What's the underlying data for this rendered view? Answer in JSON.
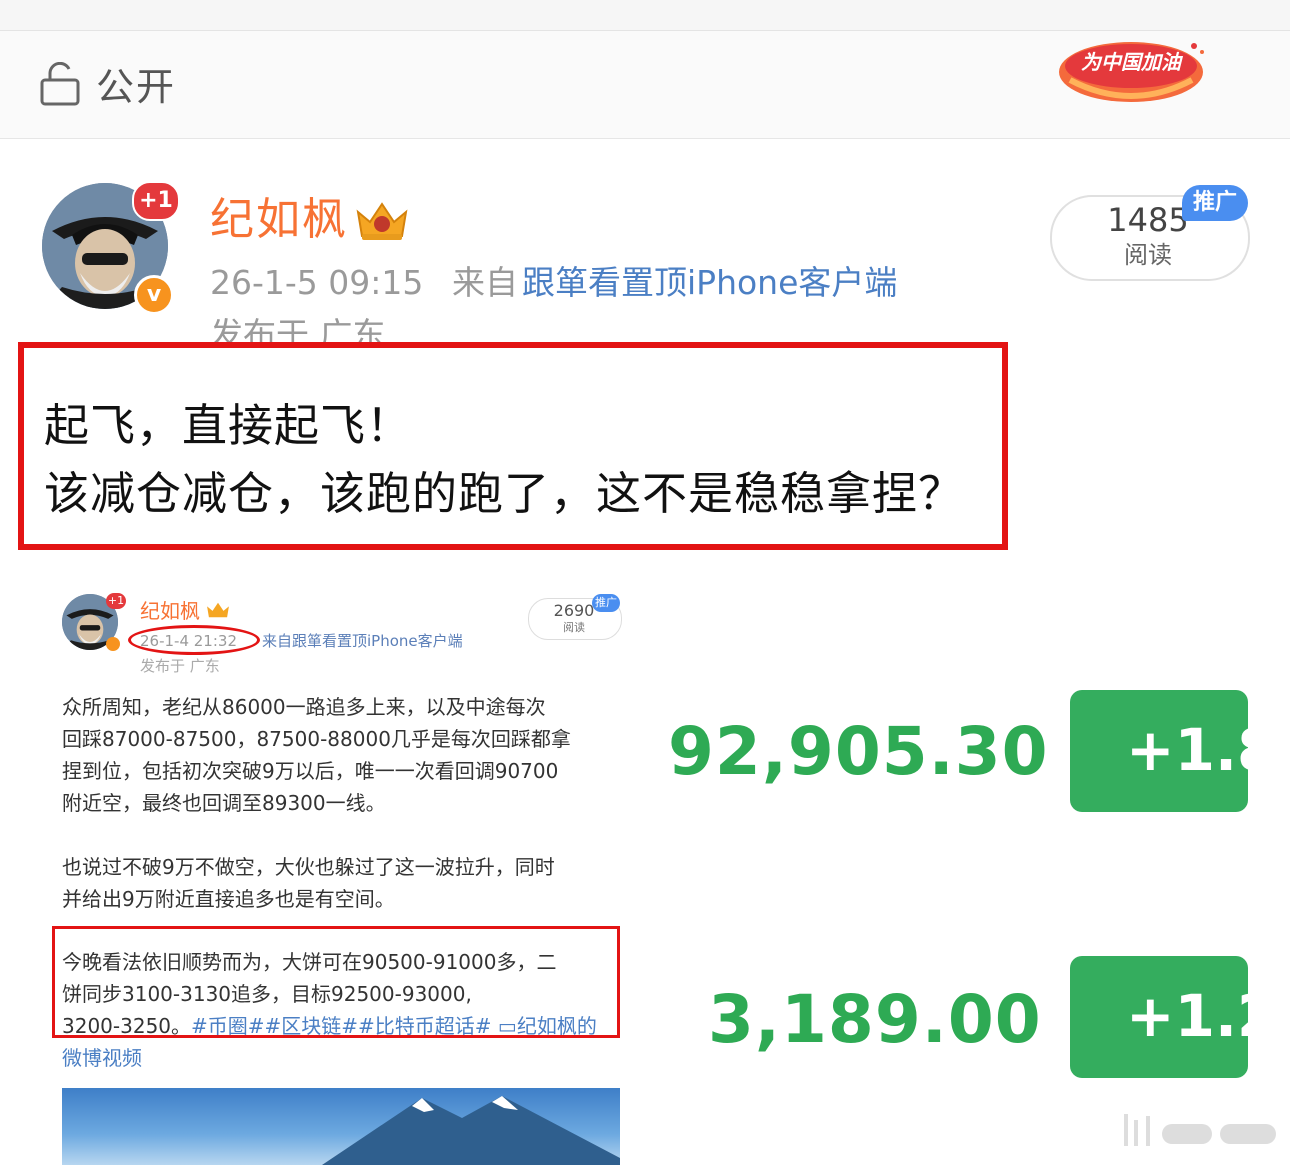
{
  "visibility": {
    "icon": "unlock-icon",
    "label": "公开"
  },
  "campaign_badge": {
    "label": "为中国加油",
    "color": "#e4393c"
  },
  "post": {
    "avatar_badge": "+1",
    "verified_mark": "v",
    "author": "纪如枫",
    "crown_icon": "crown-icon",
    "time": "26-1-5 09:15",
    "from_label": "来自",
    "client": "跟箪看置顶iPhone客户端",
    "location": "发布于 广东",
    "read_count": "1485",
    "read_label": "阅读",
    "promo_tag": "推广",
    "lines": [
      "起飞，直接起飞！",
      "该减仓减仓，该跑的跑了，这不是稳稳拿捏？"
    ]
  },
  "embedded": {
    "author": "纪如枫",
    "avatar_badge": "+1",
    "time": "26-1-4 21:32",
    "client": "来自跟箪看置顶iPhone客户端",
    "location": "发布于 广东",
    "read_count": "2690",
    "read_label": "阅读",
    "promo_tag": "推广",
    "paragraph1": [
      "众所周知，老纪从86000一路追多上来，以及中途每次",
      "回踩87000-87500，87500-88000几乎是每次回踩都拿",
      "捏到位，包括初次突破9万以后，唯一一次看回调90700",
      "附近空，最终也回调至89300一线。"
    ],
    "paragraph2": [
      "也说过不破9万不做空，大伙也躲过了这一波拉升，同时",
      "并给出9万附近直接追多也是有空间。"
    ],
    "paragraph3": [
      "今晚看法依旧顺势而为，大饼可在90500-91000多，二",
      "饼同步3100-3130追多，目标92500-93000,"
    ],
    "paragraph3_last": "3200-3250。",
    "tags": "#币圈##区块链##比特币超话# ▭纪如枫的",
    "tags_tail": "微博视频"
  },
  "prices": [
    {
      "value": "92,905.30",
      "change": "+1.8"
    },
    {
      "value": "3,189.00",
      "change": "+1.2"
    }
  ],
  "colors": {
    "accent_orange": "#f77234",
    "link_blue": "#4b7fc4",
    "highlight_red": "#e31414",
    "up_green": "#2eaa54"
  }
}
